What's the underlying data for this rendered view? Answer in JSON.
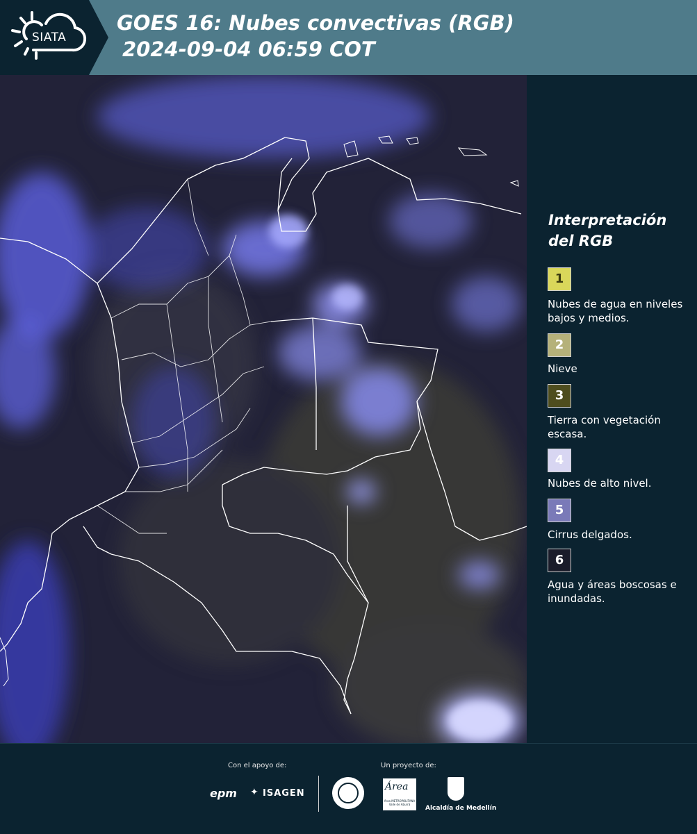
{
  "header": {
    "logo_text": "SIATA",
    "title_line1": "GOES 16: Nubes convectivas (RGB)",
    "title_line2": "2024-09-04 06:59 COT"
  },
  "legend": {
    "title": "Interpretación del RGB",
    "items": [
      {
        "number": "1",
        "label": "Nubes de agua en niveles bajos y medios.",
        "color": "#d9d75a",
        "text_color": "#3a3a10"
      },
      {
        "number": "2",
        "label": "Nieve",
        "color": "#b5b17a",
        "text_color": "#ffffff"
      },
      {
        "number": "3",
        "label": "Tierra con vegetación escasa.",
        "color": "#4e4d1e",
        "text_color": "#ffffff"
      },
      {
        "number": "4",
        "label": "Nubes de alto nivel.",
        "color": "#d8d6f2",
        "text_color": "#ffffff"
      },
      {
        "number": "5",
        "label": "Cirrus delgados.",
        "color": "#7a7ab8",
        "text_color": "#ffffff"
      },
      {
        "number": "6",
        "label": "Agua y áreas boscosas e inundadas.",
        "color": "#1a1c2a",
        "text_color": "#ffffff"
      }
    ]
  },
  "footer": {
    "support_label": "Con el apoyo de:",
    "project_label": "Un proyecto de:",
    "sponsors": [
      "epm",
      "ISAGEN"
    ],
    "partners": [
      "Área METROPOLITANA Valle de Aburrá",
      "Alcaldía de Medellín"
    ]
  },
  "map": {
    "base_color": "#222238",
    "cloud_color": "#6e72f0",
    "border_color": "#ffffff"
  }
}
